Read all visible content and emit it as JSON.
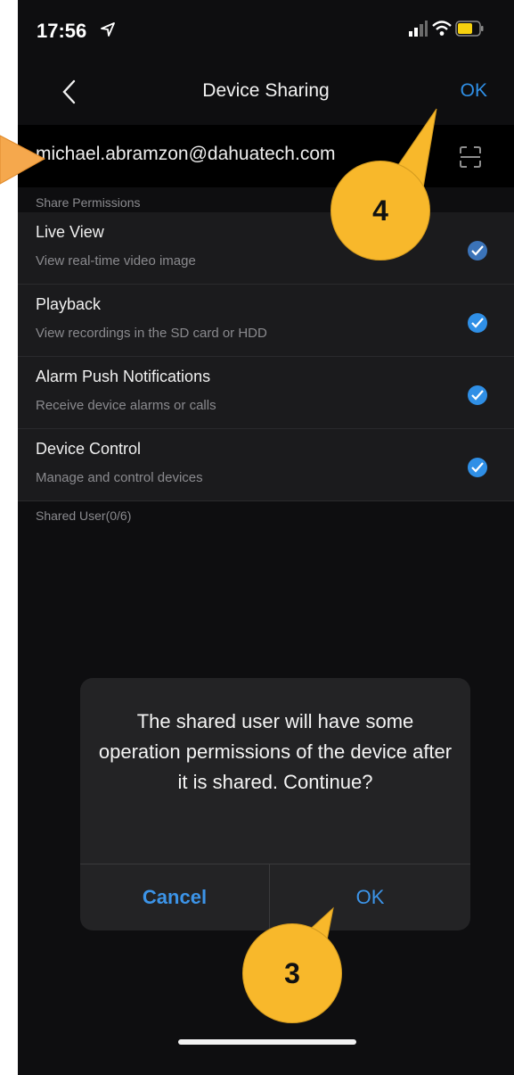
{
  "status_bar": {
    "time": "17:56"
  },
  "nav": {
    "title": "Device Sharing",
    "ok_label": "OK"
  },
  "account": {
    "email": "michael.abramzon@dahuatech.com"
  },
  "permissions": {
    "section_label": "Share Permissions",
    "items": [
      {
        "title": "Live View",
        "description": "View real-time video image",
        "checked": true
      },
      {
        "title": "Playback",
        "description": "View recordings in the SD card or HDD",
        "checked": true
      },
      {
        "title": "Alarm Push Notifications",
        "description": "Receive device alarms or calls",
        "checked": true
      },
      {
        "title": "Device Control",
        "description": "Manage and control devices",
        "checked": true
      }
    ]
  },
  "shared_users": {
    "label": "Shared User(0/6)"
  },
  "dialog": {
    "message": "The shared user will have some operation permissions of the device after it is shared. Continue?",
    "cancel_label": "Cancel",
    "ok_label": "OK"
  },
  "annotations": [
    {
      "number": "4",
      "target": "nav-ok-button"
    },
    {
      "number": "3",
      "target": "dialog-ok-button"
    }
  ],
  "colors": {
    "accent_blue": "#2f8fe6",
    "callout_fill": "#f8b82b",
    "arrow_fill": "#f5a84d",
    "background": "#0e0e10"
  }
}
